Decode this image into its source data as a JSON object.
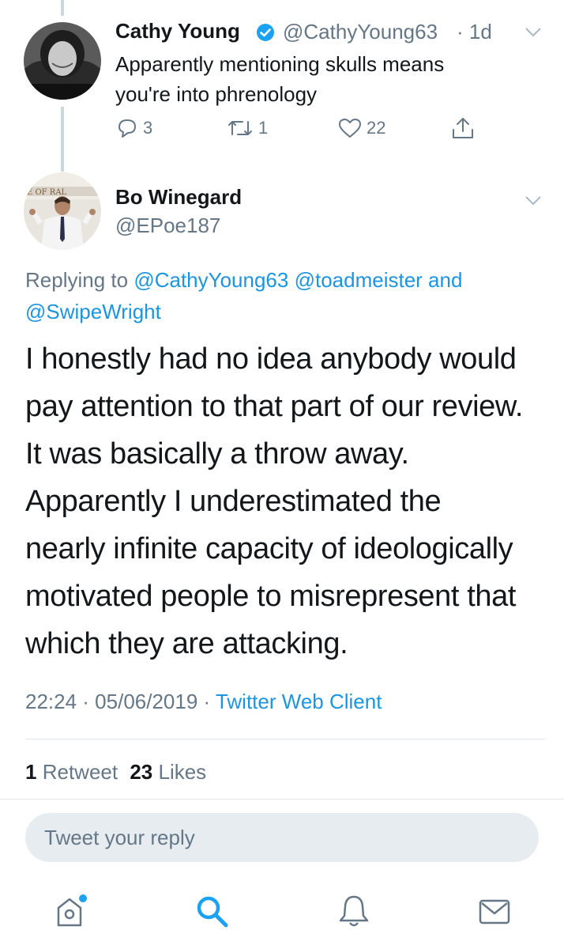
{
  "parent_tweet": {
    "name": "Cathy Young",
    "handle": "@CathyYoung63",
    "time": "· 1d",
    "text_line1": "Apparently mentioning skulls means",
    "text_line2": "you're into phrenology",
    "replies": "3",
    "retweets": "1",
    "likes": "22"
  },
  "main_tweet": {
    "name": "Bo Winegard",
    "handle": "@EPoe187",
    "replying_label": "Replying to",
    "reply_to_1": "@CathyYoung63",
    "reply_to_2": "@toadmeister",
    "reply_and": "and",
    "reply_to_3": "@SwipeWright",
    "body_lines": [
      "I honestly had no idea anybody would",
      "pay attention to that part of our review.",
      "It was basically a throw away.",
      "Apparently I underestimated the",
      "nearly infinite capacity of ideologically",
      "motivated people to misrepresent that",
      "which they are attacking."
    ],
    "timestamp": "22:24 · 05/06/2019 ·",
    "client": "Twitter Web Client",
    "retweet_count": "1",
    "retweet_label": "Retweet",
    "like_count": "23",
    "like_label": "Likes"
  },
  "reply_input": {
    "placeholder": "Tweet your reply"
  },
  "tab_bar": {
    "items": [
      {
        "icon": "home-icon",
        "active": false,
        "notification_dot": true
      },
      {
        "icon": "search-icon",
        "active": true
      },
      {
        "icon": "notifications-bell-icon",
        "active": false
      },
      {
        "icon": "messages-envelope-icon",
        "active": false
      }
    ]
  },
  "colors": {
    "accent": "#1b95e0",
    "muted": "#657786",
    "text": "#14171a",
    "verified": "#1da1f2",
    "thread_line": "#ccd6dd",
    "input_bg": "#e6ecf0"
  }
}
